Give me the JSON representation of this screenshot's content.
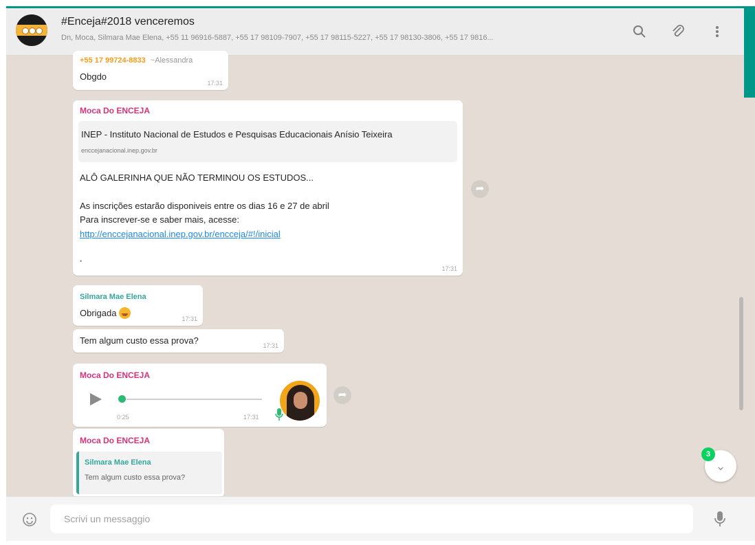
{
  "header": {
    "title": "#Enceja#2018 venceremos",
    "subtitle": "Dn, Moca, Silmara Mae Elena, +55 11 96916-5887, +55 17 98109-7907, +55 17 98115-5227, +55 17 98130-3806, +55 17 9816..."
  },
  "messages": {
    "m1": {
      "sender": "+55 17 99724-8833",
      "author": "~Alessandra",
      "text": "Obgdo",
      "time": "17:31"
    },
    "m2": {
      "sender": "Moca Do ENCEJA",
      "preview_title": "INEP - Instituto Nacional de Estudos e Pesquisas Educacionais Anísio Teixeira",
      "preview_url": "encceja­nacional.inep.gov.br",
      "line1": "ALÔ GALERINHA QUE NÃO TERMINOU OS ESTUDOS...",
      "line2": "As inscrições estarão disponiveis entre os dias 16 e 27 de abril",
      "line3": "Para inscrever-se e saber mais, acesse:",
      "link": "http://encceja­nacional.inep.gov.br/encceja/#!/inicial",
      "dot": "•",
      "time": "17:31"
    },
    "m3": {
      "sender": "Silmara Mae Elena",
      "text": "Obrigada",
      "time": "17:31"
    },
    "m4": {
      "text": "Tem algum custo essa prova?",
      "time": "17:31"
    },
    "m5": {
      "sender": "Moca Do ENCEJA",
      "duration": "0:25",
      "time": "17:31"
    },
    "m6": {
      "sender": "Moca Do ENCEJA",
      "quoted_sender": "Silmara Mae Elena",
      "quoted_text": "Tem algum custo essa prova?"
    }
  },
  "composer": {
    "placeholder": "Scrivi un messaggio"
  },
  "unread_count": "3",
  "icons": [
    "search-icon",
    "paperclip-icon",
    "menu-icon",
    "emoji-icon",
    "microphone-icon",
    "forward-icon",
    "play-icon",
    "chevron-down-icon"
  ],
  "colors": {
    "accent": "#009688",
    "sender_pink": "#d6337a",
    "sender_green": "#35a89b",
    "sender_orange": "#f59c1a",
    "link": "#1e88e5"
  }
}
